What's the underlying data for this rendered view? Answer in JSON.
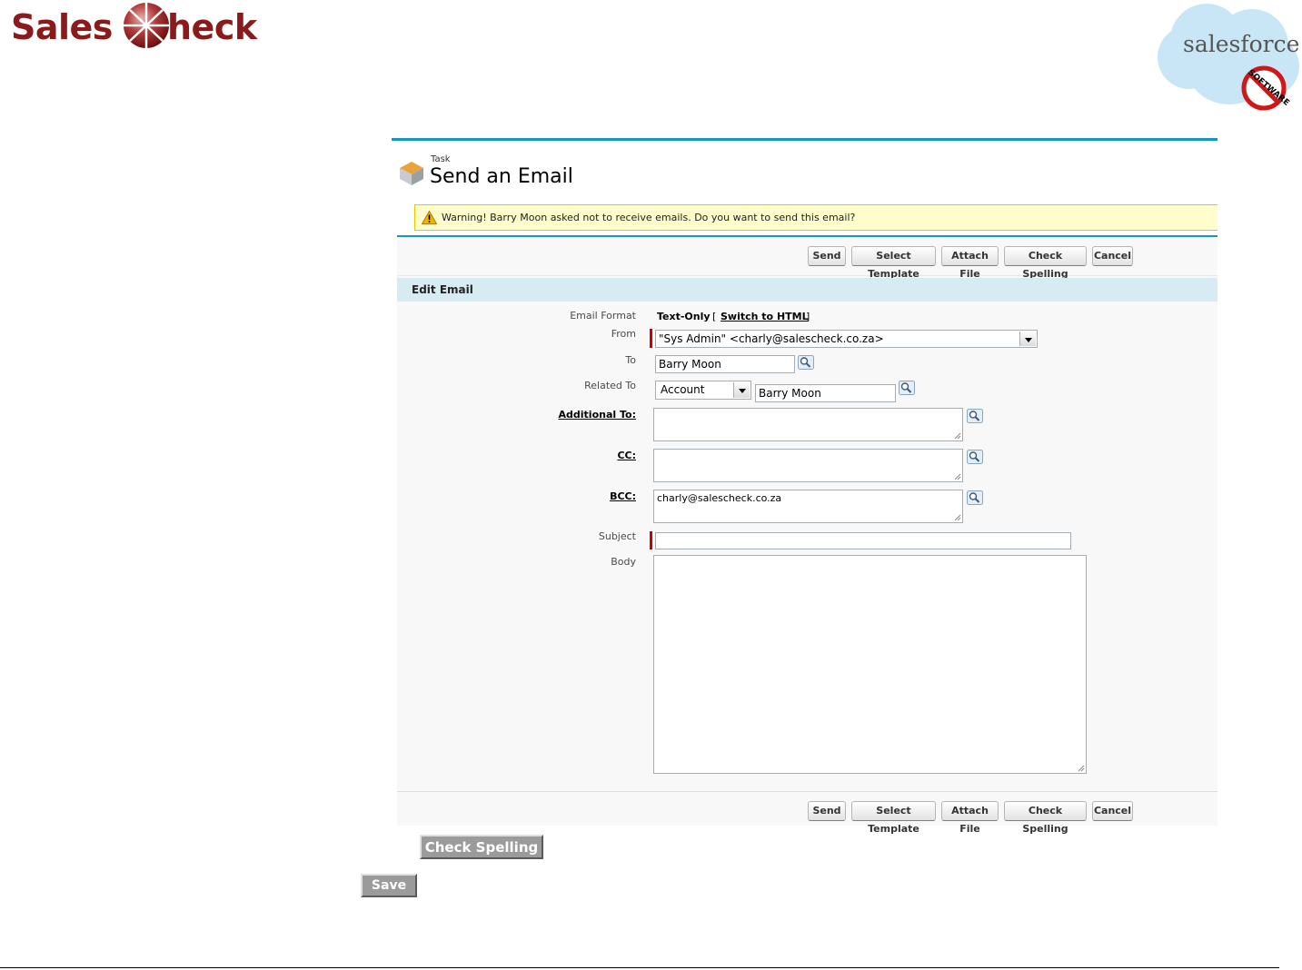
{
  "brand": {
    "left_logo_text_a": "Sales",
    "left_logo_text_b": "heck",
    "right_logo_text": "salesforce",
    "right_badge_text": "SOFTWARE",
    "brand_color": "#8b1a1a",
    "accent_color": "#1797c0"
  },
  "header": {
    "object_label": "Task",
    "title": "Send an Email"
  },
  "warning": {
    "text": "Warning! Barry Moon asked not to receive emails. Do you want to send this email?",
    "icon": "warning-triangle-icon"
  },
  "toolbar": {
    "send": "Send",
    "select_template": "Select Template",
    "attach_file": "Attach File",
    "check_spelling": "Check Spelling",
    "cancel": "Cancel"
  },
  "section": {
    "title": "Edit Email"
  },
  "form": {
    "email_format_label": "Email Format",
    "email_format_value": "Text-Only",
    "switch_open": "[",
    "switch_link": "Switch to HTML",
    "switch_close": "]",
    "from_label": "From",
    "from_value": "\"Sys Admin\" <charly@salescheck.co.za>",
    "to_label": "To",
    "to_value": "Barry Moon",
    "related_to_label": "Related To",
    "related_type_value": "Account",
    "related_name_value": "Barry Moon",
    "additional_to_label": "Additional To:",
    "additional_to_value": "",
    "cc_label": "CC:",
    "cc_value": "",
    "bcc_label": "BCC:",
    "bcc_value": "charly@salescheck.co.za",
    "subject_label": "Subject",
    "subject_value": "",
    "body_label": "Body",
    "body_value": ""
  },
  "extra_buttons": {
    "check_spelling": "Check Spelling",
    "save": "Save"
  }
}
